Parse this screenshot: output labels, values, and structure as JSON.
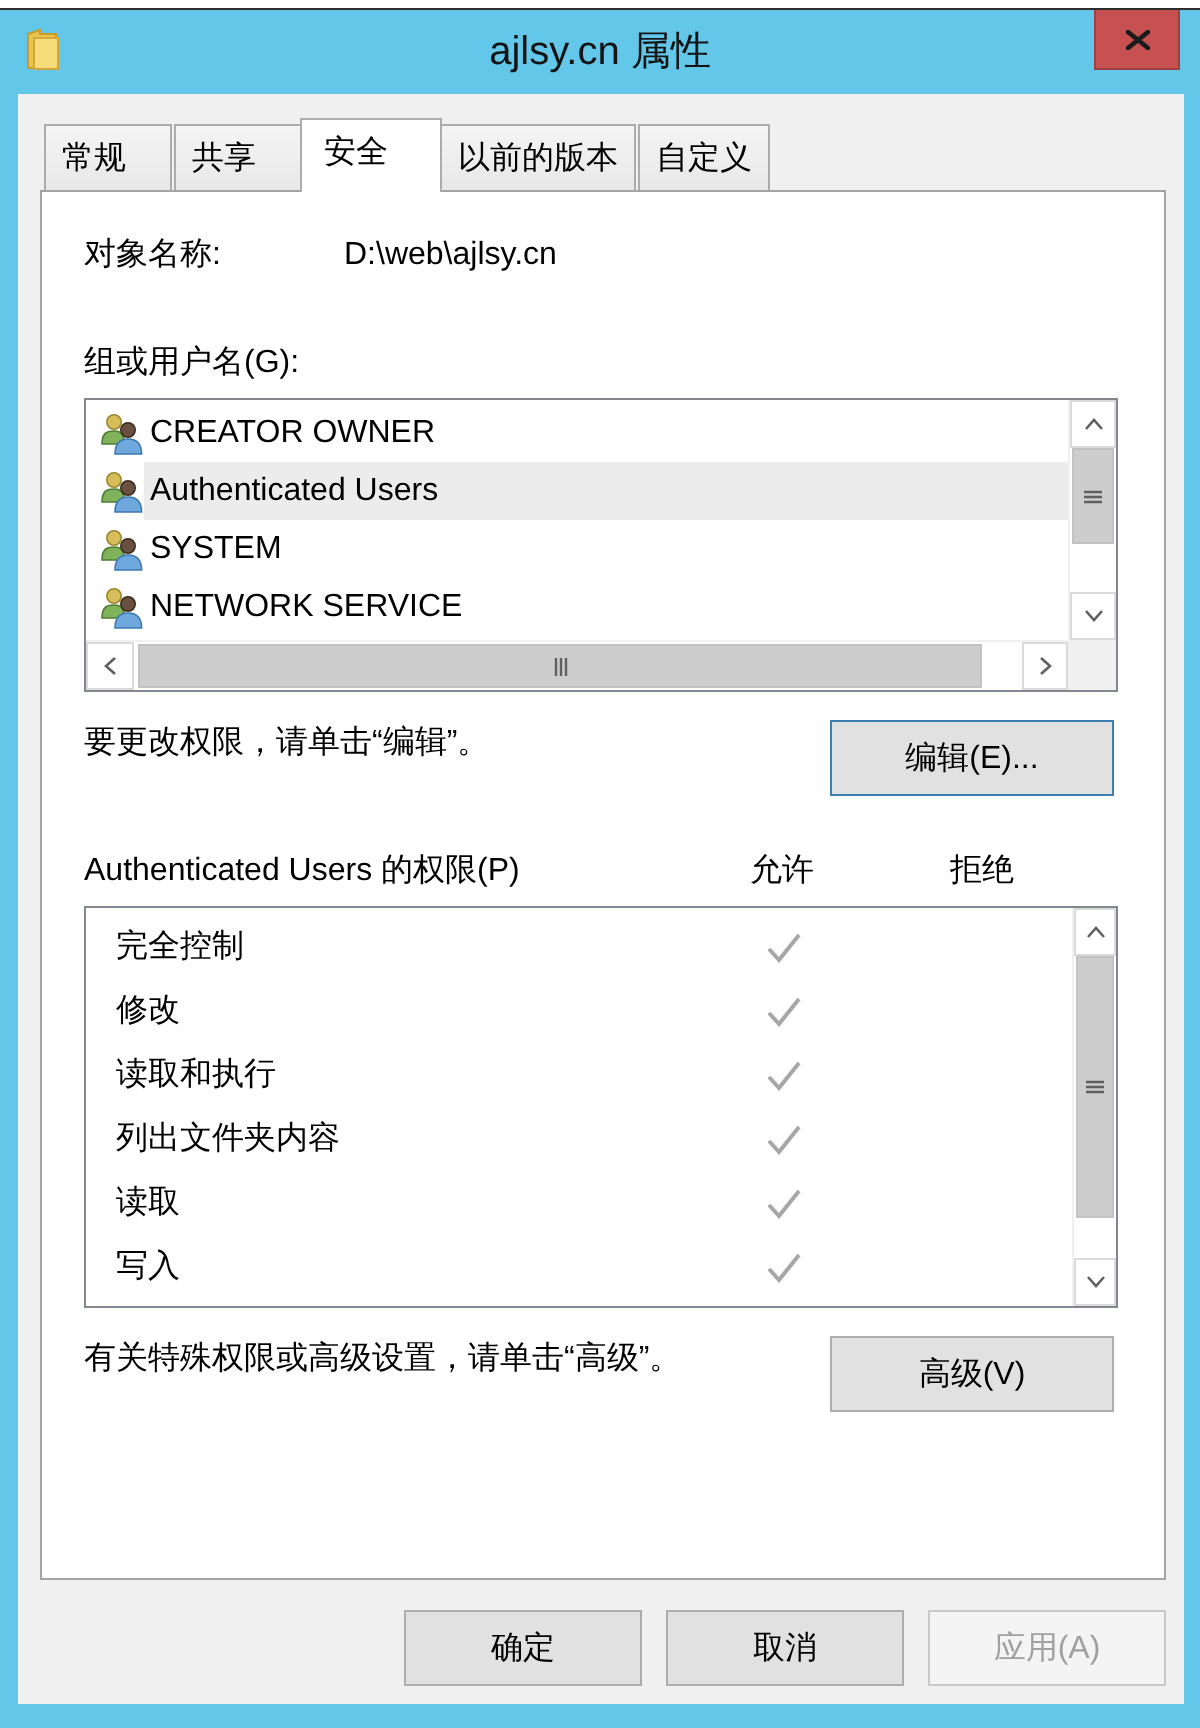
{
  "window": {
    "title": "ajlsy.cn 属性"
  },
  "tabs": [
    {
      "label": "常规",
      "selected": false
    },
    {
      "label": "共享",
      "selected": false
    },
    {
      "label": "安全",
      "selected": true
    },
    {
      "label": "以前的版本",
      "selected": false
    },
    {
      "label": "自定义",
      "selected": false
    }
  ],
  "object_name": {
    "label": "对象名称:",
    "value": "D:\\web\\ajlsy.cn"
  },
  "group_list": {
    "label": "组或用户名(G):",
    "items": [
      {
        "name": "CREATOR OWNER",
        "selected": false
      },
      {
        "name": "Authenticated Users",
        "selected": true
      },
      {
        "name": "SYSTEM",
        "selected": false
      },
      {
        "name": "NETWORK SERVICE",
        "selected": false
      }
    ]
  },
  "edit_section": {
    "hint": "要更改权限，请单击“编辑”。",
    "button": {
      "label": "编辑(E)...",
      "focused": true
    }
  },
  "permissions": {
    "title": "Authenticated Users 的权限(P)",
    "columns": [
      "允许",
      "拒绝"
    ],
    "rows": [
      {
        "name": "完全控制",
        "allow": true,
        "deny": false
      },
      {
        "name": "修改",
        "allow": true,
        "deny": false
      },
      {
        "name": "读取和执行",
        "allow": true,
        "deny": false
      },
      {
        "name": "列出文件夹内容",
        "allow": true,
        "deny": false
      },
      {
        "name": "读取",
        "allow": true,
        "deny": false
      },
      {
        "name": "写入",
        "allow": true,
        "deny": false
      }
    ]
  },
  "advanced_section": {
    "hint": "有关特殊权限或高级设置，请单击“高级”。",
    "button": {
      "label": "高级(V)",
      "focused": false
    }
  },
  "buttons": [
    {
      "label": "确定",
      "disabled": false
    },
    {
      "label": "取消",
      "disabled": false
    },
    {
      "label": "应用(A)",
      "disabled": true
    }
  ]
}
